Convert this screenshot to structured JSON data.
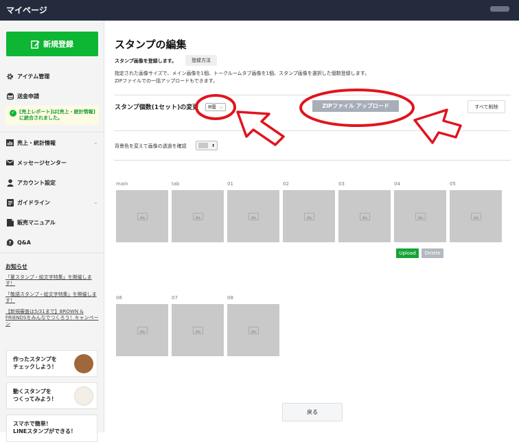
{
  "topbar": {
    "title": "マイページ"
  },
  "sidebar": {
    "new_button": "新規登録",
    "items": [
      {
        "label": "アイテム管理",
        "icon": "gear-icon"
      },
      {
        "label": "送金申請",
        "icon": "database-icon"
      },
      {
        "label": "売上・統計情報",
        "icon": "chart-icon",
        "expandable": true
      },
      {
        "label": "メッセージセンター",
        "icon": "mail-icon"
      },
      {
        "label": "アカウント設定",
        "icon": "person-icon"
      },
      {
        "label": "ガイドライン",
        "icon": "document-icon",
        "expandable": true
      },
      {
        "label": "販売マニュアル",
        "icon": "manual-icon"
      },
      {
        "label": "Q&A",
        "icon": "question-icon"
      }
    ],
    "notice": "[売上レポート]は[売上・統計情報]に統合されました。",
    "news_heading": "お知らせ",
    "news": [
      "「夏スタンプ・絵文字特集」を開催します！",
      "「敬語スタンプ・絵文字特集」を開催します！",
      "【新規審査は5/31まで】BROWN & FRIENDSをみんなでつくろう！キャンペーン"
    ],
    "promos": [
      {
        "line1": "作ったスタンプを",
        "line2": "チェックしよう！"
      },
      {
        "line1": "動くスタンプを",
        "line2": "つくってみよう！"
      },
      {
        "line1": "スマホで簡単！",
        "line2": "LINEスタンプができる！"
      }
    ]
  },
  "main": {
    "title": "スタンプの編集",
    "subtitle": "スタンプ画像を登録します。",
    "howto_button": "登録方法",
    "description": [
      "指定された画像サイズで、メイン画像を1個、トークルームタブ画像を1個、スタンプ画像を選択した個数登録します。",
      "ZIPファイルでの一括アップロードもできます。"
    ],
    "count_label": "スタンプ個数(1セット)の変更",
    "count_value": "8個",
    "zip_button": "ZIPファイル アップロード",
    "delete_all_button": "すべて削除",
    "bg_label": "背景色を変えて画像の透過を確認",
    "slots_row1": [
      "main",
      "tab",
      "01",
      "02",
      "03",
      "04",
      "05"
    ],
    "slots_row2": [
      "06",
      "07",
      "08"
    ],
    "upload_button": "Upload",
    "delete_button": "Delete",
    "back_button": "戻る"
  },
  "colors": {
    "accent": "#0db633",
    "topbar": "#232b3d",
    "annotation": "#e0141e"
  }
}
